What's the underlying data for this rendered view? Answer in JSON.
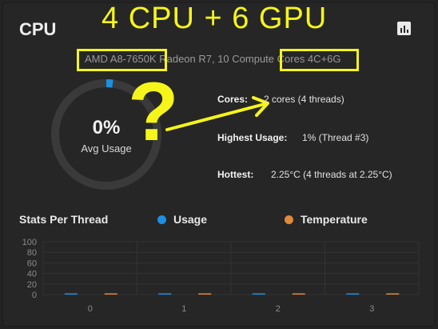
{
  "card": {
    "title": "CPU"
  },
  "annotation": {
    "headline": "4 CPU + 6 GPU",
    "question_mark": "?"
  },
  "cpu_name": "AMD A8-7650K Radeon R7, 10 Compute Cores 4C+6G",
  "gauge": {
    "percent": "0%",
    "label": "Avg Usage",
    "value_fraction": 0.02,
    "accent": "#1e8fe0"
  },
  "stats": {
    "cores_label": "Cores:",
    "cores_value": "2 cores  (4 threads)",
    "highest_label": "Highest Usage:",
    "highest_value": "1%  (Thread #3)",
    "hottest_label": "Hottest:",
    "hottest_value": "2.25°C  (4 threads at 2.25°C)"
  },
  "per_thread": {
    "title": "Stats Per Thread",
    "legend": [
      {
        "name": "Usage",
        "color": "#1e8fe0"
      },
      {
        "name": "Temperature",
        "color": "#e08a3a"
      }
    ]
  },
  "chart_data": {
    "type": "bar",
    "categories": [
      "0",
      "1",
      "2",
      "3"
    ],
    "yticks": [
      "100",
      "80",
      "60",
      "40",
      "20",
      "0"
    ],
    "ylim": [
      0,
      100
    ],
    "series": [
      {
        "name": "Usage",
        "values": [
          0,
          0,
          0,
          1
        ],
        "color": "#1e8fe0"
      },
      {
        "name": "Temperature",
        "values": [
          2.25,
          2.25,
          2.25,
          2.25
        ],
        "color": "#e08a3a"
      }
    ]
  }
}
